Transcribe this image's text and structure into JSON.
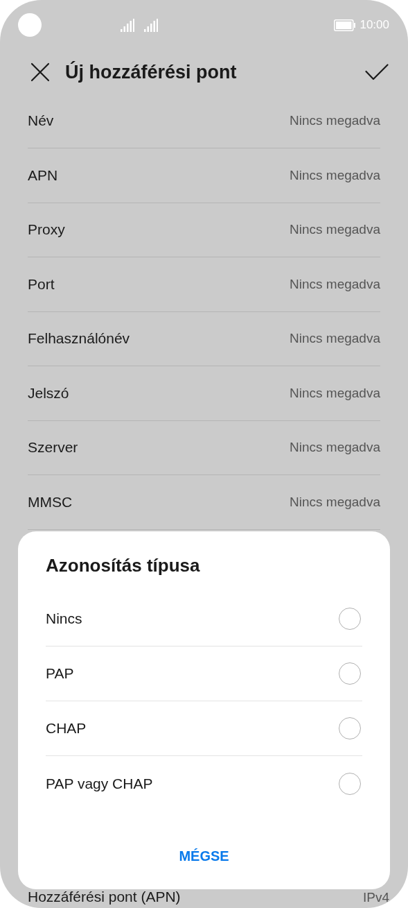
{
  "status_bar": {
    "time": "10:00"
  },
  "app_bar": {
    "title": "Új hozzáférési pont"
  },
  "settings": [
    {
      "label": "Név",
      "value": "Nincs megadva"
    },
    {
      "label": "APN",
      "value": "Nincs megadva"
    },
    {
      "label": "Proxy",
      "value": "Nincs megadva"
    },
    {
      "label": "Port",
      "value": "Nincs megadva"
    },
    {
      "label": "Felhasználónév",
      "value": "Nincs megadva"
    },
    {
      "label": "Jelszó",
      "value": "Nincs megadva"
    },
    {
      "label": "Szerver",
      "value": "Nincs megadva"
    },
    {
      "label": "MMSC",
      "value": "Nincs megadva"
    }
  ],
  "partial_setting": {
    "label": "Hozzáférési pont (APN)",
    "value": "IPv4"
  },
  "dialog": {
    "title": "Azonosítás típusa",
    "options": [
      {
        "label": "Nincs",
        "selected": false
      },
      {
        "label": "PAP",
        "selected": false
      },
      {
        "label": "CHAP",
        "selected": false
      },
      {
        "label": "PAP vagy CHAP",
        "selected": false
      }
    ],
    "cancel": "MÉGSE"
  }
}
